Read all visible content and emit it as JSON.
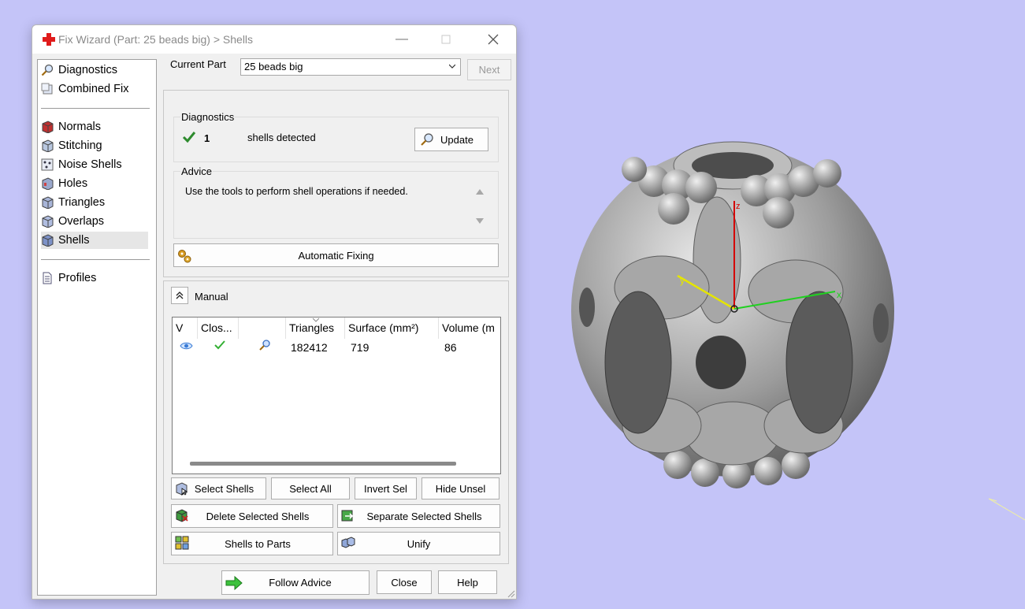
{
  "window": {
    "title": "Fix Wizard (Part: 25 beads big) > Shells"
  },
  "sidebar": {
    "items": [
      {
        "label": "Diagnostics",
        "icon": "magnifier-icon"
      },
      {
        "label": "Combined Fix",
        "icon": "combined-fix-icon"
      },
      {
        "label": "Normals",
        "icon": "normals-cube-icon"
      },
      {
        "label": "Stitching",
        "icon": "stitching-cube-icon"
      },
      {
        "label": "Noise Shells",
        "icon": "noise-shells-icon"
      },
      {
        "label": "Holes",
        "icon": "holes-cube-icon"
      },
      {
        "label": "Triangles",
        "icon": "triangles-cube-icon"
      },
      {
        "label": "Overlaps",
        "icon": "overlaps-cube-icon"
      },
      {
        "label": "Shells",
        "icon": "shells-cube-icon"
      },
      {
        "label": "Profiles",
        "icon": "document-icon"
      }
    ],
    "selected": "Shells"
  },
  "part": {
    "label": "Current Part",
    "value": "25 beads big",
    "next_label": "Next"
  },
  "diagnostics": {
    "title": "Diagnostics",
    "count": "1",
    "text": "shells detected",
    "update_label": "Update"
  },
  "advice": {
    "title": "Advice",
    "text": "Use the tools to perform shell operations if needed."
  },
  "automatic_fixing_label": "Automatic Fixing",
  "manual": {
    "label": "Manual",
    "columns": [
      "V",
      "Clos...",
      "",
      "Triangles",
      "Surface (mm²)",
      "Volume (m"
    ],
    "rows": [
      {
        "triangles": "182412",
        "surface": "719",
        "volume": "86"
      }
    ]
  },
  "actions": {
    "select_shells": "Select Shells",
    "select_all": "Select All",
    "invert_sel": "Invert Sel",
    "hide_unsel": "Hide Unsel",
    "delete_selected": "Delete Selected Shells",
    "separate_selected": "Separate Selected Shells",
    "shells_to_parts": "Shells to Parts",
    "unify": "Unify"
  },
  "footer": {
    "follow_advice": "Follow Advice",
    "close": "Close",
    "help": "Help"
  },
  "viewport": {
    "axis_labels": [
      "z",
      "y",
      "x"
    ],
    "background_color": "#c4c4f8"
  }
}
